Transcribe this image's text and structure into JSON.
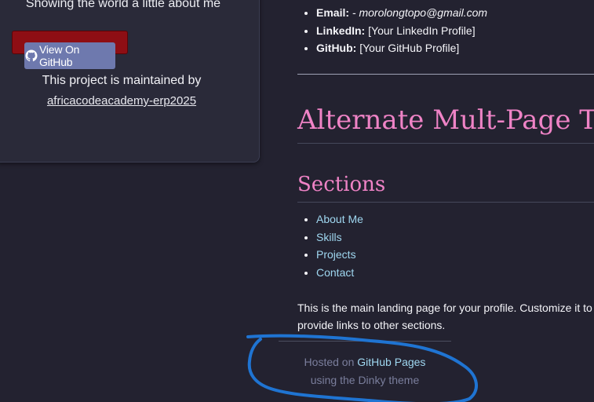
{
  "sidebar": {
    "tagline": "Showing the world a little about me",
    "github_button": {
      "label": "View On GitHub",
      "icon": "github-icon"
    },
    "maintained_text": "This project is maintained by",
    "maintainer_link": "africacodeacademy-erp2025"
  },
  "contact": {
    "items": [
      {
        "key": "Email:",
        "value": "- morolongtopo@gmail.com"
      },
      {
        "key": "LinkedIn:",
        "value": "[Your LinkedIn Profile]"
      },
      {
        "key": "GitHub:",
        "value": "[Your GitHub Profile]"
      }
    ]
  },
  "main": {
    "title": "Alternate Mult-Page T",
    "sections_heading": "Sections",
    "sections": [
      {
        "label": "About Me"
      },
      {
        "label": "Skills"
      },
      {
        "label": "Projects"
      },
      {
        "label": "Contact"
      }
    ],
    "landing_line1": "This is the main landing page for your profile. Customize it to",
    "landing_line2": "provide links to other sections."
  },
  "footer": {
    "hosted_prefix": "Hosted on ",
    "hosted_link": "GitHub Pages",
    "theme_text": "using the Dinky theme"
  },
  "colors": {
    "background": "#232230",
    "heading_pink": "#ef83c6",
    "link_blue": "#9fd7f0",
    "button_blue": "#6e79ae",
    "red_bar": "#8e0e14",
    "annotation_blue": "#1f74d2"
  }
}
